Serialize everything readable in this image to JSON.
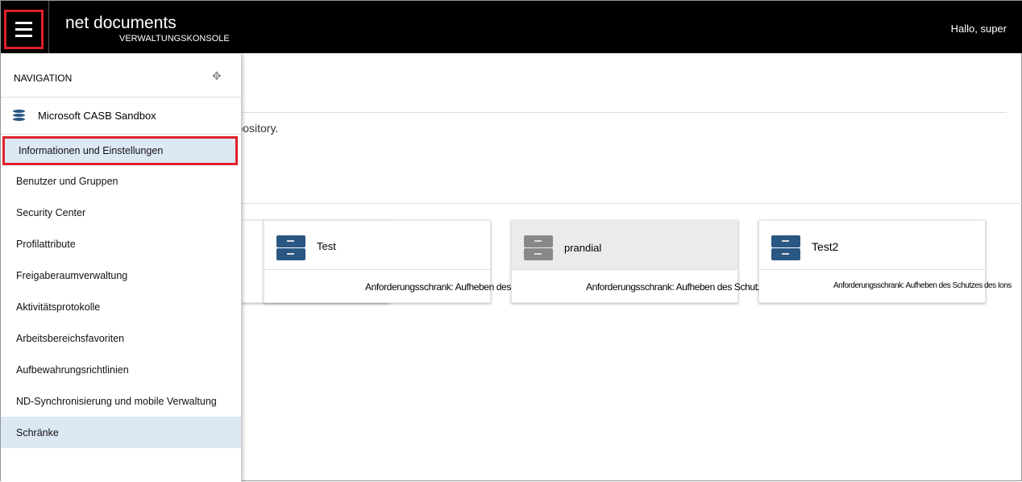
{
  "header": {
    "brand": "net documents",
    "subtitle": "VERWALTUNGSKONSOLE",
    "greeting": "Hallo, super"
  },
  "main": {
    "description_fragment": "repository.",
    "cabinets": [
      {
        "name": "Test",
        "footer": "Anforderungsschrank: Aufheben des Schutzes des Ions",
        "color": "#2a5783"
      },
      {
        "name": "prandial",
        "footer": "Anforderungsschrank: Aufheben des Schutzes des Ions",
        "color": "#888888"
      },
      {
        "name": "Test2",
        "footer": "Anforderungsschrank: Aufheben des Schutzes des Ions",
        "color": "#2a5783"
      }
    ]
  },
  "sidebar": {
    "title": "NAVIGATION",
    "repository": "Microsoft CASB Sandbox",
    "items": [
      {
        "label": "Informationen und Einstellungen"
      },
      {
        "label": "Benutzer und Gruppen"
      },
      {
        "label": "Security Center"
      },
      {
        "label": "Profilattribute"
      },
      {
        "label": "Freigaberaumverwaltung"
      },
      {
        "label": "Aktivitätsprotokolle"
      },
      {
        "label": "Arbeitsbereichsfavoriten"
      },
      {
        "label": "Aufbewahrungsrichtlinien"
      },
      {
        "label": "ND-Synchronisierung und mobile Verwaltung"
      },
      {
        "label": "Schränke"
      }
    ]
  },
  "colors": {
    "highlight": "#e0202a",
    "brand_blue": "#2a5783"
  }
}
